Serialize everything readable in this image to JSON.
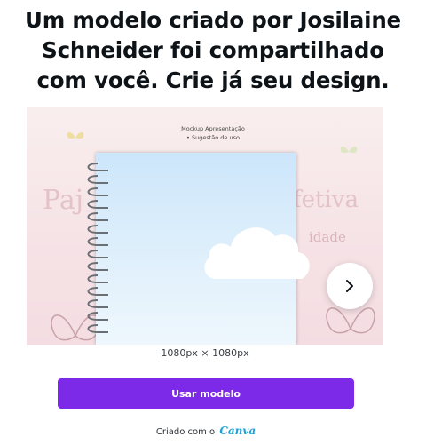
{
  "headline": {
    "line1": "Um modelo criado por Josilaine",
    "line2": "Schneider foi compartilhado",
    "line3": "com você. Crie já seu design."
  },
  "preview": {
    "mockup_title_line1": "Mockup Apresentação",
    "mockup_title_line2": "• Sugestão de uso",
    "background_left_text": "Paj",
    "background_right_text": "fetiva",
    "background_sub_text": "idade",
    "next_icon": "chevron-right-icon"
  },
  "dimensions": "1080px × 1080px",
  "cta": {
    "label": "Usar modelo"
  },
  "credit": {
    "prefix": "Criado com o",
    "brand": "Canva"
  },
  "colors": {
    "cta_background": "#7d2ae8",
    "cta_text": "#ffffff",
    "brand_logo": "#1e9fd8",
    "preview_background": "#f6e3e6",
    "notebook_cover": "#cde6fb"
  }
}
